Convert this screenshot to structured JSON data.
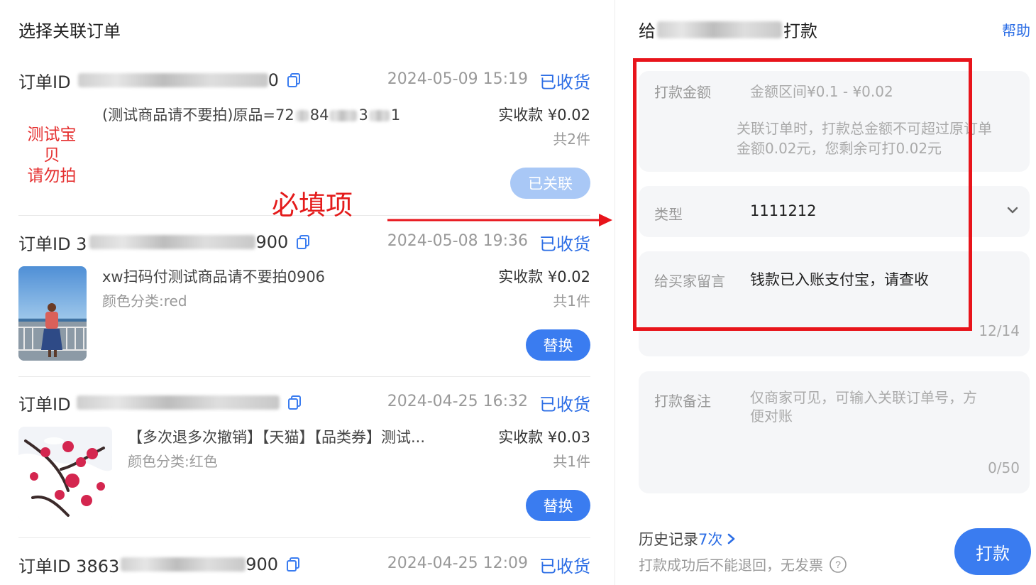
{
  "left_title": "选择关联订单",
  "orders": [
    {
      "id_label": "订单ID",
      "id_visible_prefix": "",
      "id_visible_suffix": "0",
      "date": "2024-05-09 15:19",
      "status": "已收货",
      "product": "(测试商品请不要拍)原品=72",
      "product_tail": "84",
      "product_tail2": "3",
      "product_tail3": "1",
      "spec": "",
      "paid": "实收款 ¥0.02",
      "qty": "共2件",
      "action": "已关联"
    },
    {
      "id_label": "订单ID 3",
      "id_visible_prefix": "",
      "id_visible_suffix": "900",
      "date": "2024-05-08 19:36",
      "status": "已收货",
      "product": "xw扫码付测试商品请不要拍0906",
      "spec": "颜色分类:red",
      "paid": "实收款 ¥0.02",
      "qty": "共1件",
      "action": "替换"
    },
    {
      "id_label": "订单ID",
      "id_visible_prefix": "",
      "id_visible_suffix": "",
      "date": "2024-04-25 16:32",
      "status": "已收货",
      "product": "【多次退多次撤销】【天猫】【品类券】测试...",
      "spec": "颜色分类:红色",
      "paid": "实收款 ¥0.03",
      "qty": "共1件",
      "action": "替换"
    },
    {
      "id_label": "订单ID 3863",
      "id_visible_prefix": "",
      "id_visible_suffix": "900",
      "date": "2024-04-25 12:09",
      "status": "已收货"
    }
  ],
  "annotations": {
    "test_item": "测试宝贝\n请勿拍",
    "test_item_line1": "测试宝贝",
    "test_item_line2": "请勿拍",
    "required": "必填项",
    "highlight_color": "#e8141b"
  },
  "right": {
    "title_prefix": "给",
    "title_suffix": "打款",
    "help": "帮助",
    "amount_label": "打款金额",
    "amount_placeholder": "金额区间¥0.1 - ¥0.02",
    "amount_note_line1": "关联订单时，打款总金额不可超过原订单",
    "amount_note_line2": "金额0.02元，您剩余可打0.02元",
    "type_label": "类型",
    "type_value": "1111212",
    "message_label": "给买家留言",
    "message_value": "钱款已入账支付宝，请查收",
    "message_counter": "12/14",
    "remark_label": "打款备注",
    "remark_placeholder_line1": "仅商家可见，可输入关联订单号，方",
    "remark_placeholder_line2": "便对账",
    "remark_counter": "0/50",
    "history_label": "历史记录",
    "history_count": "7次",
    "disclaimer": "打款成功后不能退回，无发票",
    "pay_button": "打款"
  },
  "colors": {
    "accent": "#2b6de5",
    "button": "#3a7cf0",
    "button_disabled": "#a9c8f6",
    "annotation_red": "#e8141b"
  }
}
